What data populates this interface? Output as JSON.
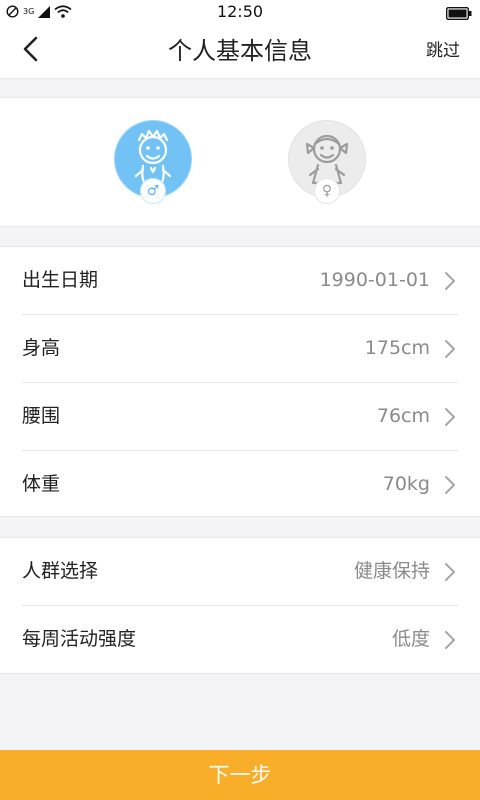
{
  "status_bar": {
    "time": "12:50",
    "signal_text": "3G"
  },
  "header": {
    "title": "个人基本信息",
    "skip_label": "跳过"
  },
  "gender": {
    "options": [
      {
        "id": "male",
        "symbol": "♂",
        "selected": true
      },
      {
        "id": "female",
        "symbol": "♀",
        "selected": false
      }
    ]
  },
  "basic_info": [
    {
      "label": "出生日期",
      "value": "1990-01-01"
    },
    {
      "label": "身高",
      "value": "175cm"
    },
    {
      "label": "腰围",
      "value": "76cm"
    },
    {
      "label": "体重",
      "value": "70kg"
    }
  ],
  "activity_info": [
    {
      "label": "人群选择",
      "value": "健康保持"
    },
    {
      "label": "每周活动强度",
      "value": "低度"
    }
  ],
  "footer": {
    "next_label": "下一步"
  },
  "colors": {
    "accent": "#f9ae2a",
    "male_avatar": "#73c2f5",
    "female_avatar": "#ececec"
  }
}
